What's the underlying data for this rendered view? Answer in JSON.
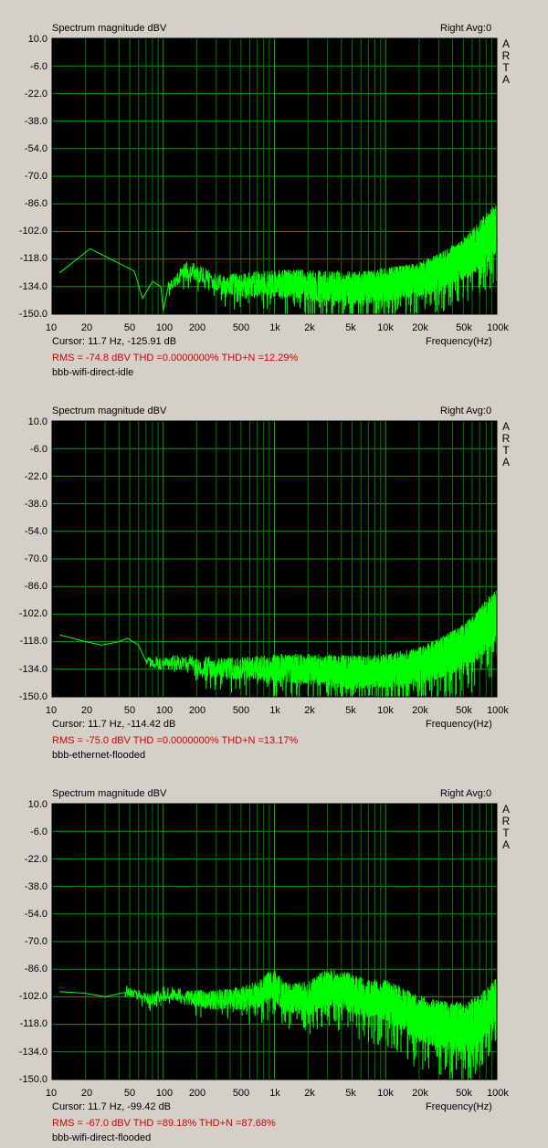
{
  "chart_data": [
    {
      "type": "line",
      "title": "Spectrum magnitude dBV",
      "channel_label": "Right  Avg:0",
      "brand_letters": [
        "A",
        "R",
        "T",
        "A"
      ],
      "xlabel": "Frequency(Hz)",
      "x_scale": "log",
      "xlim": [
        10,
        100000
      ],
      "ylim": [
        -150,
        10
      ],
      "y_ticks": [
        "10.0",
        "-6.0",
        "-22.0",
        "-38.0",
        "-54.0",
        "-70.0",
        "-86.0",
        "-102.0",
        "-118.0",
        "-134.0",
        "-150.0"
      ],
      "x_ticks": [
        "10",
        "20",
        "50",
        "100",
        "200",
        "500",
        "1k",
        "2k",
        "5k",
        "10k",
        "20k",
        "50k",
        "100k"
      ],
      "grid": true,
      "line_color": "#00ff00",
      "cursor_text": "Cursor:   11.7 Hz, -125.91 dB",
      "stats_text": "RMS =  -74.8 dBV    THD =0.0000000%    THD+N =12.29%",
      "caption": "bbb-wifi-direct-idle",
      "series": [
        {
          "x": [
            11.7,
            22,
            55,
            65,
            80,
            95,
            100,
            110,
            130,
            160,
            200,
            300,
            500,
            1000,
            2000,
            5000,
            10000,
            20000,
            30000,
            50000,
            70000,
            90000,
            100000
          ],
          "y": [
            -126,
            -112,
            -125,
            -141,
            -131,
            -134,
            -148,
            -133,
            -130,
            -124,
            -126,
            -132,
            -133,
            -132,
            -133,
            -135,
            -133,
            -130,
            -126,
            -118,
            -110,
            -103,
            -100
          ],
          "noise": [
            0,
            0,
            0,
            0,
            0,
            0,
            0,
            4,
            4,
            5,
            5,
            6,
            7,
            8,
            9,
            10,
            10,
            10,
            11,
            12,
            14,
            16,
            14
          ]
        }
      ]
    },
    {
      "type": "line",
      "title": "Spectrum magnitude dBV",
      "channel_label": "Right  Avg:0",
      "brand_letters": [
        "A",
        "R",
        "T",
        "A"
      ],
      "xlabel": "Frequency(Hz)",
      "x_scale": "log",
      "xlim": [
        10,
        100000
      ],
      "ylim": [
        -150,
        10
      ],
      "y_ticks": [
        "10.0",
        "-6.0",
        "-22.0",
        "-38.0",
        "-54.0",
        "-70.0",
        "-86.0",
        "-102.0",
        "-118.0",
        "-134.0",
        "-150.0"
      ],
      "x_ticks": [
        "10",
        "20",
        "50",
        "100",
        "200",
        "500",
        "1k",
        "2k",
        "5k",
        "10k",
        "20k",
        "50k",
        "100k"
      ],
      "grid": true,
      "line_color": "#00ff00",
      "cursor_text": "Cursor:   11.7 Hz, -114.42 dB",
      "stats_text": "RMS =  -75.0 dBV    THD =0.0000000%    THD+N =13.17%",
      "caption": "bbb-ethernet-flooded",
      "series": [
        {
          "x": [
            11.7,
            20,
            28,
            40,
            48,
            60,
            70,
            85,
            100,
            150,
            200,
            300,
            500,
            1000,
            2000,
            5000,
            10000,
            20000,
            30000,
            50000,
            70000,
            90000,
            100000
          ],
          "y": [
            -114,
            -118,
            -120,
            -118,
            -116,
            -120,
            -128,
            -130,
            -131,
            -130,
            -132,
            -133,
            -134,
            -133,
            -134,
            -136,
            -135,
            -132,
            -128,
            -121,
            -113,
            -106,
            -102
          ],
          "noise": [
            0,
            0,
            0,
            0,
            0,
            0,
            3,
            4,
            4,
            5,
            6,
            6,
            7,
            8,
            9,
            10,
            10,
            11,
            12,
            13,
            15,
            16,
            14
          ]
        }
      ]
    },
    {
      "type": "line",
      "title": "Spectrum magnitude dBV",
      "channel_label": "Right  Avg:0",
      "brand_letters": [
        "A",
        "R",
        "T",
        "A"
      ],
      "xlabel": "Frequency(Hz)",
      "x_scale": "log",
      "xlim": [
        10,
        100000
      ],
      "ylim": [
        -150,
        10
      ],
      "y_ticks": [
        "10.0",
        "-6.0",
        "-22.0",
        "-38.0",
        "-54.0",
        "-70.0",
        "-86.0",
        "-102.0",
        "-118.0",
        "-134.0",
        "-150.0"
      ],
      "x_ticks": [
        "10",
        "20",
        "50",
        "100",
        "200",
        "500",
        "1k",
        "2k",
        "5k",
        "10k",
        "20k",
        "50k",
        "100k"
      ],
      "grid": true,
      "line_color": "#00ff00",
      "cursor_text": "Cursor:   11.7 Hz, -99.42 dB",
      "stats_text": "RMS =  -67.0 dBV    THD =89.18%    THD+N =87.68%",
      "caption": "bbb-wifi-direct-flooded",
      "series": [
        {
          "x": [
            11.7,
            20,
            30,
            45,
            60,
            80,
            100,
            150,
            200,
            300,
            500,
            700,
            900,
            1000,
            1200,
            2000,
            3000,
            4000,
            5000,
            7000,
            10000,
            15000,
            20000,
            30000,
            50000,
            70000,
            90000,
            100000
          ],
          "y": [
            -99,
            -100,
            -102,
            -98,
            -101,
            -104,
            -100,
            -102,
            -103,
            -104,
            -103,
            -101,
            -96,
            -95,
            -102,
            -103,
            -96,
            -98,
            -100,
            -104,
            -104,
            -110,
            -115,
            -118,
            -120,
            -116,
            -108,
            -102
          ],
          "noise": [
            0,
            0,
            0,
            3,
            3,
            4,
            4,
            5,
            5,
            6,
            7,
            8,
            9,
            9,
            9,
            10,
            11,
            11,
            12,
            12,
            12,
            13,
            14,
            14,
            15,
            15,
            14,
            12
          ]
        }
      ]
    }
  ]
}
